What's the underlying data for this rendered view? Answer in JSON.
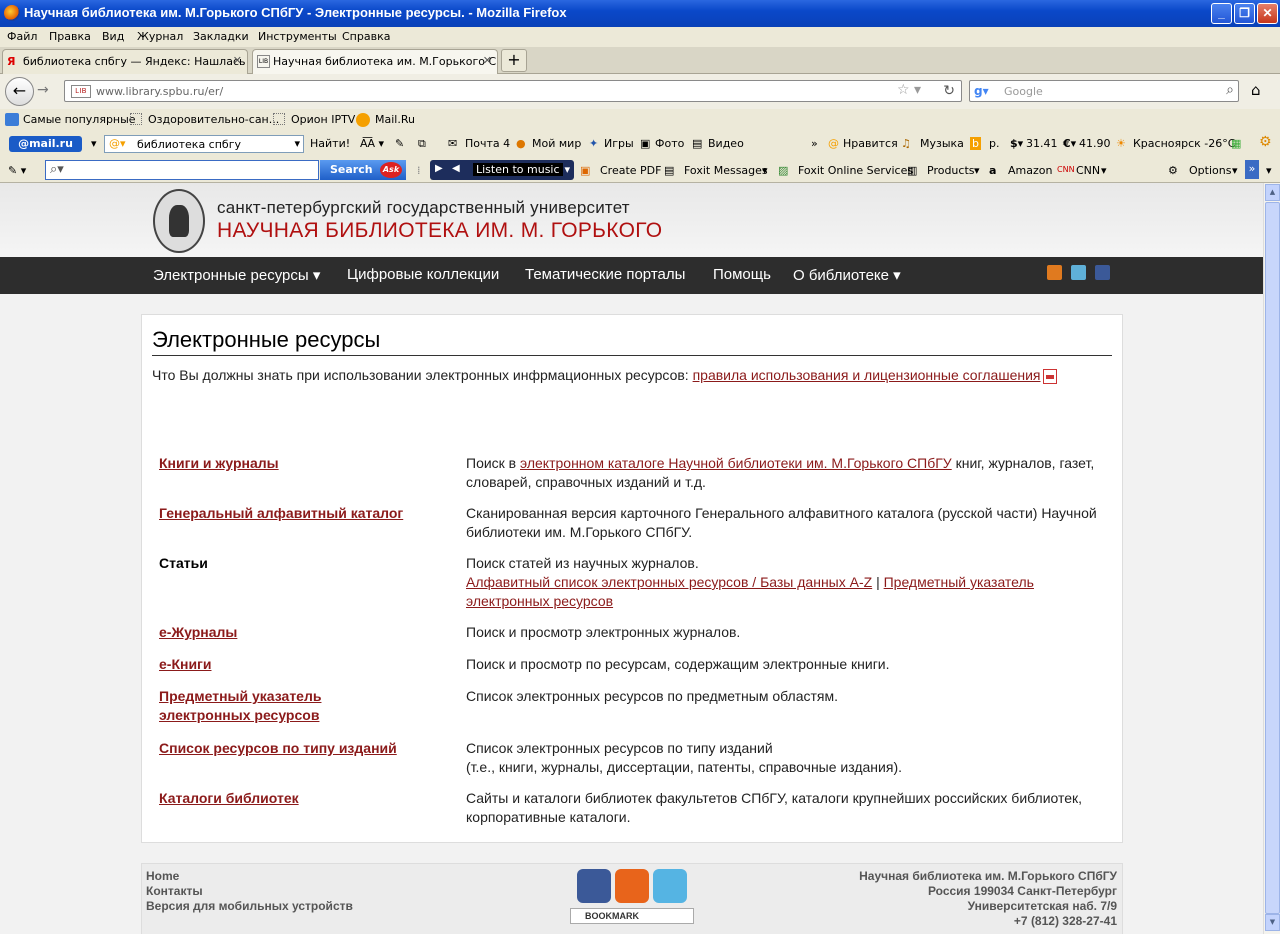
{
  "window": {
    "title": "Научная библиотека им. М.Горького СПбГУ - Электронные ресурсы. - Mozilla Firefox",
    "controls": [
      "_",
      "❐",
      "✕"
    ]
  },
  "menu": [
    "Файл",
    "Правка",
    "Вид",
    "Журнал",
    "Закладки",
    "Инструменты",
    "Справка"
  ],
  "tabs": [
    {
      "label": "библиотека спбгу — Яндекс: Нашлась ...",
      "icon": "yandex-icon"
    },
    {
      "label": "Научная библиотека им. М.Горького С...",
      "icon": "library-icon"
    }
  ],
  "address": {
    "url": "www.library.spbu.ru/er/",
    "favicon_text": "LIB"
  },
  "search": {
    "placeholder": "Google"
  },
  "bookmarks": [
    "Самые популярные",
    "Оздоровительно-сан...",
    "Орион IPTV",
    "Mail.Ru"
  ],
  "mailru_toolbar": {
    "logo": "@mail.ru",
    "search_value": "библиотека спбгу",
    "find": "Найти!",
    "items": [
      "Почта 4",
      "Мой мир",
      "Игры",
      "Фото",
      "Видео",
      "Нравится",
      "Музыка",
      "р.",
      "31.41",
      "41.90",
      "Красноярск -26°C"
    ]
  },
  "ask_toolbar": {
    "search_button": "Search",
    "ask_logo": "Ask",
    "listen": "Listen to music",
    "items": [
      "Create PDF",
      "Foxit Messages",
      "Foxit Online Services",
      "Products",
      "Amazon",
      "CNN",
      "Options"
    ]
  },
  "site": {
    "university": "санкт-петербургский государственный университет",
    "library": "НАУЧНАЯ БИБЛИОТЕКА ИМ. М. ГОРЬКОГО",
    "nav": [
      "Электронные ресурсы ▾",
      "Цифровые коллекции",
      "Тематические порталы",
      "Помощь",
      "О библиотеке ▾"
    ]
  },
  "content": {
    "title": "Электронные ресурсы",
    "intro_text": "Что Вы должны знать при использовании электронных инфрмационных ресурсов: ",
    "intro_link": "правила использования и лицензионные соглашения",
    "rows": [
      {
        "name": "Книги и журналы",
        "pre": "Поиск в ",
        "link": "электронном каталоге Научной библиотеки им. М.Горького СПбГУ",
        "post": " книг, журналов, газет, словарей, справочных изданий и т.д."
      },
      {
        "name": "Генеральный алфавитный каталог",
        "desc": "Сканированная версия карточного Генерального алфавитного каталога (русской части) Научной библиотеки им. М.Горького СПбГУ."
      },
      {
        "name": "Статьи",
        "desc": "Поиск статей из научных журналов.",
        "link1": "Алфавитный список электронных ресурсов / Базы данных A-Z",
        "sep": " | ",
        "link2": "Предметный указатель электронных ресурсов"
      },
      {
        "name": "е-Журналы",
        "desc": "Поиск и просмотр электронных журналов."
      },
      {
        "name": "е-Книги",
        "desc": "Поиск и просмотр по ресурсам, содержащим электронные книги."
      },
      {
        "name": "Предметный указатель электронных ресурсов",
        "desc": "Список электронных ресурсов по предметным областям."
      },
      {
        "name": "Список ресурсов по типу изданий",
        "desc": "Список электронных ресурсов по типу изданий",
        "desc2": "(т.е., книги, журналы, диссертации, патенты, справочные издания)."
      },
      {
        "name": "Каталоги библиотек",
        "desc": "Сайты и каталоги библиотек факультетов СПбГУ, каталоги крупнейших российских библиотек, корпоративные каталоги."
      }
    ]
  },
  "footer": {
    "links": [
      "Home",
      "Контакты",
      "Версия для мобильных устройств"
    ],
    "bookmark": "BOOKMARK",
    "address": [
      "Научная библиотека им. М.Горького СПбГУ",
      "Россия 199034 Санкт-Петербург",
      "Университетская наб. 7/9",
      "+7 (812) 328-27-41"
    ]
  },
  "colors": {
    "link": "#8b1a1a",
    "nav_bg": "#2d2d2d",
    "title_red": "#b01010"
  }
}
